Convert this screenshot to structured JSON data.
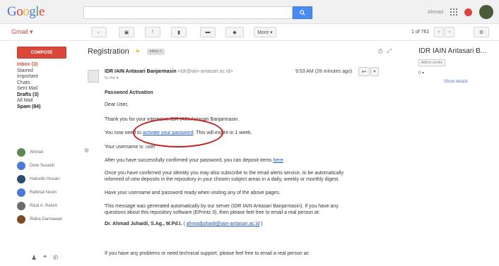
{
  "brand": {
    "logo": [
      "G",
      "o",
      "o",
      "g",
      "l",
      "e"
    ]
  },
  "topbar": {
    "user_name": "Ahmad"
  },
  "toolbar": {
    "gmail_label": "Gmail ▾",
    "more_label": "More ▾",
    "pager": "1 of 761"
  },
  "nav": {
    "compose_label": "COMPOSE",
    "items": [
      {
        "label": "Inbox (3)"
      },
      {
        "label": "Starred"
      },
      {
        "label": "Important"
      },
      {
        "label": "Chats"
      },
      {
        "label": "Sent Mail"
      },
      {
        "label": "Drafts (3)"
      },
      {
        "label": "All Mail"
      },
      {
        "label": "Spam (84)"
      }
    ]
  },
  "contacts": [
    {
      "name": "Ahmad",
      "color": "#5b8a4c"
    },
    {
      "name": "Dewi Susanti",
      "color": "#4a7bd8"
    },
    {
      "name": "Hairudin Husain",
      "color": "#2b4e6e"
    },
    {
      "name": "Rahmat Noviri",
      "color": "#4a7bd8"
    },
    {
      "name": "Rizal A. Rahim",
      "color": "#6b6b6b"
    },
    {
      "name": "Ridha Darmawan",
      "color": "#7a4a2a"
    }
  ],
  "email": {
    "subject": "Registration",
    "label_chip": "Inbox ×",
    "sender_name": "IDR IAIN Antasari Banjarmasin",
    "sender_addr": "<idr@iain-antasari.ac.id>",
    "to_line": "to me ▾",
    "timestamp": "9:53 AM (28 minutes ago)",
    "body": {
      "heading": "Password Activation",
      "greeting": "Dear User,",
      "thanks": "Thank you for your interest in IDR IAIN Antasari Banjarmasin.",
      "activate_prefix": "You now need to",
      "activate_link": "activate your password",
      "activate_suffix": ". This will expire in 1 week.",
      "username_line": "Your username is: user",
      "deposit_prefix": "After you have successfully confirmed your password, you can deposit items",
      "deposit_link": "here",
      "alerts_1": "Once you have confirmed your identity you may also subscribe to the email alerts service, to be automatically",
      "alerts_2": "informed of new deposits in the repository in your chosen subject areas in a daily, weekly or monthly digest.",
      "ready_line": "Have your username and password ready when visiting any of the above pages.",
      "auto_1": "This message was generated automatically by our server (IDR IAIN Antasari Banjarmasin). If you have any",
      "auto_2": "questions about this repository software (EPrints 3), then please feel free to email a real person at:",
      "contact_name": "Dr. Ahmad Juhaidi, S.Ag., M.Pd.I.",
      "contact_email": "ahmadjuhaidi@iain-antasari.ac.id",
      "footer": "If you have any problems or need technical support, please feel free to email a real person at:"
    }
  },
  "right_panel": {
    "title": "IDR IAIN Antasari B...",
    "chip": "Add to circles",
    "stat": "0 ▾",
    "link": "Show details"
  }
}
